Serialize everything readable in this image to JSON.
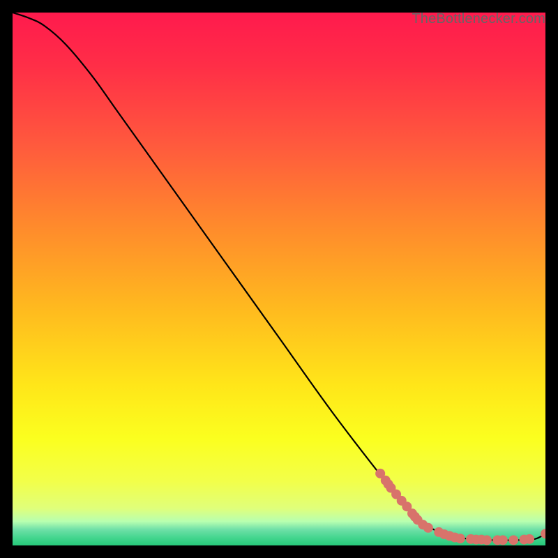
{
  "watermark": "TheBottlenecker.com",
  "chart_data": {
    "type": "line",
    "title": "",
    "xlabel": "",
    "ylabel": "",
    "xlim": [
      0,
      100
    ],
    "ylim": [
      0,
      100
    ],
    "background_gradient_stops": [
      {
        "offset": 0.0,
        "color": "#ff1a4d"
      },
      {
        "offset": 0.1,
        "color": "#ff2e47"
      },
      {
        "offset": 0.25,
        "color": "#ff5a3d"
      },
      {
        "offset": 0.4,
        "color": "#ff8a2c"
      },
      {
        "offset": 0.55,
        "color": "#ffb81f"
      },
      {
        "offset": 0.7,
        "color": "#ffe619"
      },
      {
        "offset": 0.8,
        "color": "#fbff1f"
      },
      {
        "offset": 0.88,
        "color": "#f2ff4a"
      },
      {
        "offset": 0.93,
        "color": "#e0ff7a"
      },
      {
        "offset": 0.955,
        "color": "#b8ffb0"
      },
      {
        "offset": 0.97,
        "color": "#6fe0a8"
      },
      {
        "offset": 0.985,
        "color": "#45d68f"
      },
      {
        "offset": 1.0,
        "color": "#26c97a"
      }
    ],
    "curve": {
      "x": [
        0,
        3,
        6,
        10,
        15,
        20,
        30,
        40,
        50,
        60,
        70,
        75,
        80,
        85,
        90,
        95,
        98,
        100
      ],
      "y": [
        100,
        99,
        97.5,
        94,
        88,
        81,
        67,
        53,
        39,
        25,
        12,
        6,
        2.5,
        1.3,
        1,
        1,
        1.2,
        2.2
      ]
    },
    "scatter_points": {
      "x": [
        69,
        70,
        70.5,
        71,
        72,
        73,
        74,
        75,
        75.5,
        76,
        77,
        78,
        80,
        81,
        82,
        83,
        84,
        86,
        87,
        88,
        89,
        91,
        92,
        94,
        96,
        97,
        100
      ],
      "y": [
        13.5,
        12.2,
        11.5,
        10.8,
        9.6,
        8.4,
        7.3,
        6.0,
        5.4,
        4.8,
        3.9,
        3.3,
        2.5,
        2.1,
        1.8,
        1.5,
        1.3,
        1.2,
        1.1,
        1.1,
        1.0,
        1.0,
        1.0,
        1.0,
        1.1,
        1.2,
        2.2
      ],
      "color": "#d8736b",
      "radius": 7
    }
  }
}
